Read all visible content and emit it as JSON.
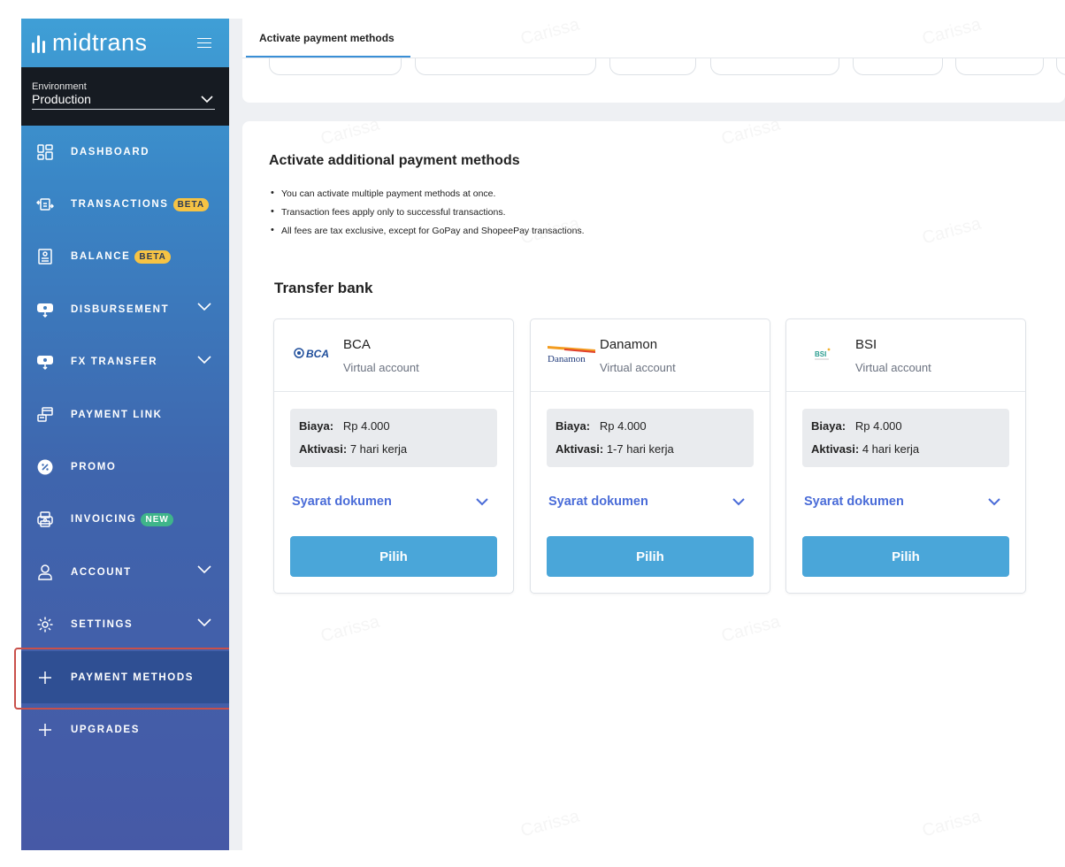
{
  "sidebar": {
    "brand": "midtrans",
    "environment": {
      "label": "Environment",
      "value": "Production"
    },
    "items": [
      {
        "label": "DASHBOARD",
        "icon": "dashboard-icon",
        "badge": "",
        "chevron": false
      },
      {
        "label": "TRANSACTIONS",
        "icon": "transactions-icon",
        "badge": "BETA",
        "chevron": false
      },
      {
        "label": "BALANCE",
        "icon": "balance-icon",
        "badge": "BETA",
        "chevron": false
      },
      {
        "label": "DISBURSEMENT",
        "icon": "disbursement-icon",
        "badge": "",
        "chevron": true
      },
      {
        "label": "FX TRANSFER",
        "icon": "fx-transfer-icon",
        "badge": "",
        "chevron": true
      },
      {
        "label": "PAYMENT LINK",
        "icon": "payment-link-icon",
        "badge": "",
        "chevron": false
      },
      {
        "label": "PROMO",
        "icon": "promo-icon",
        "badge": "",
        "chevron": false
      },
      {
        "label": "INVOICING",
        "icon": "invoicing-icon",
        "badge": "NEW",
        "chevron": false
      },
      {
        "label": "ACCOUNT",
        "icon": "account-icon",
        "badge": "",
        "chevron": true
      },
      {
        "label": "SETTINGS",
        "icon": "settings-icon",
        "badge": "",
        "chevron": true
      },
      {
        "label": "PAYMENT METHODS",
        "icon": "plus-icon",
        "badge": "",
        "chevron": false
      },
      {
        "label": "UPGRADES",
        "icon": "plus-icon",
        "badge": "",
        "chevron": false
      }
    ]
  },
  "tabs": {
    "active": "Activate payment methods"
  },
  "main": {
    "title": "Activate additional payment methods",
    "bullets": [
      "You can activate multiple payment methods at once.",
      "Transaction fees apply only to successful transactions.",
      "All fees are tax exclusive, except for GoPay and ShopeePay transactions."
    ],
    "section": "Transfer bank",
    "fee_label": "Biaya:",
    "activation_label": "Aktivasi:",
    "docs_label": "Syarat dokumen",
    "button_label": "Pilih",
    "banks": [
      {
        "name": "BCA",
        "type": "Virtual account",
        "fee": "Rp 4.000",
        "activation": "7 hari kerja",
        "logo_text": "BCA"
      },
      {
        "name": "Danamon",
        "type": "Virtual account",
        "fee": "Rp 4.000",
        "activation": "1-7 hari kerja",
        "logo_text": "Danamon"
      },
      {
        "name": "BSI",
        "type": "Virtual account",
        "fee": "Rp 4.000",
        "activation": "4 hari kerja",
        "logo_text": "BSI"
      }
    ]
  },
  "watermark": "Carissa",
  "colors": {
    "accent": "#4aa6d9",
    "link": "#4a6cd8",
    "highlight": "#c9504a"
  }
}
